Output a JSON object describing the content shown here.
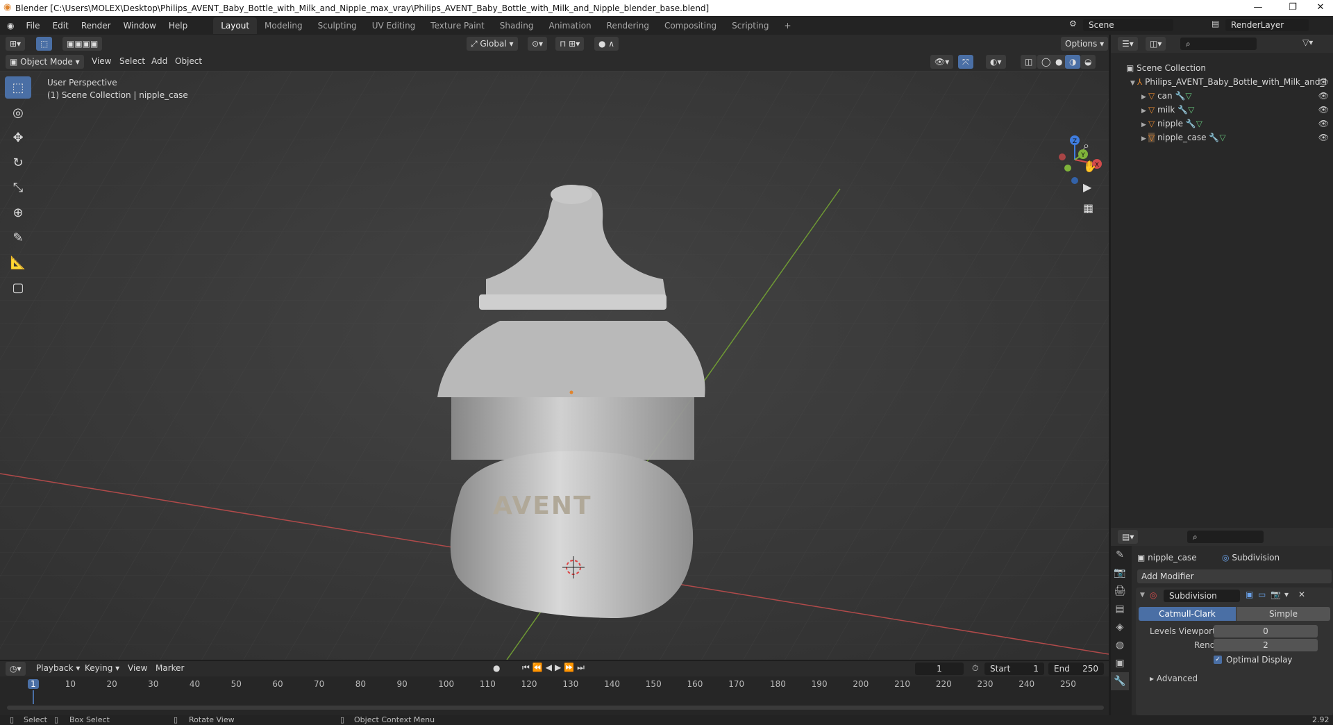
{
  "window": {
    "title": "Blender [C:\\Users\\MOLEX\\Desktop\\Philips_AVENT_Baby_Bottle_with_Milk_and_Nipple_max_vray\\Philips_AVENT_Baby_Bottle_with_Milk_and_Nipple_blender_base.blend]"
  },
  "menu": {
    "file": "File",
    "edit": "Edit",
    "render": "Render",
    "window": "Window",
    "help": "Help"
  },
  "workspaces": [
    "Layout",
    "Modeling",
    "Sculpting",
    "UV Editing",
    "Texture Paint",
    "Shading",
    "Animation",
    "Rendering",
    "Compositing",
    "Scripting"
  ],
  "scene": {
    "name": "Scene",
    "render_layer": "RenderLayer"
  },
  "viewport_header": {
    "mode": "Object Mode",
    "view": "View",
    "select": "Select",
    "add": "Add",
    "object": "Object",
    "transform": "Global",
    "options": "Options"
  },
  "viewport": {
    "perspective": "User Perspective",
    "collection": "(1) Scene Collection | nipple_case",
    "logo_text": "AVENT",
    "gizmo": {
      "x": "X",
      "y": "Y",
      "z": "Z"
    }
  },
  "outliner": {
    "root": "Scene Collection",
    "collection": "Philips_AVENT_Baby_Bottle_with_Milk_and_l",
    "items": [
      {
        "name": "can"
      },
      {
        "name": "milk"
      },
      {
        "name": "nipple"
      },
      {
        "name": "nipple_case"
      }
    ]
  },
  "properties": {
    "object": "nipple_case",
    "modifier_tab": "Subdivision",
    "add_modifier": "Add Modifier",
    "modifier_name": "Subdivision",
    "catmull": "Catmull-Clark",
    "simple": "Simple",
    "levels_label": "Levels Viewport",
    "levels_value": "0",
    "render_label": "Render",
    "render_value": "2",
    "optimal": "Optimal Display",
    "advanced": "Advanced"
  },
  "timeline": {
    "playback": "Playback",
    "keying": "Keying",
    "view": "View",
    "marker": "Marker",
    "current": "1",
    "start_label": "Start",
    "start": "1",
    "end_label": "End",
    "end": "250",
    "ticks": [
      "1",
      "10",
      "20",
      "30",
      "40",
      "50",
      "60",
      "70",
      "80",
      "90",
      "100",
      "110",
      "120",
      "130",
      "140",
      "150",
      "160",
      "170",
      "180",
      "190",
      "200",
      "210",
      "220",
      "230",
      "240",
      "250"
    ]
  },
  "status": {
    "select": "Select",
    "box_select": "Box Select",
    "rotate": "Rotate View",
    "context": "Object Context Menu",
    "version": "2.92"
  },
  "colors": {
    "accent": "#4a6fa5",
    "x_axis": "#d24b4b",
    "y_axis": "#7fb33a",
    "object": "#e0852f"
  }
}
